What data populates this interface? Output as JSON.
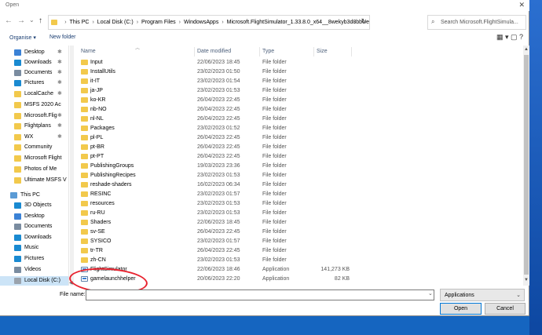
{
  "window": {
    "title": "Open",
    "close_glyph": "✕"
  },
  "nav_buttons": {
    "back": "←",
    "forward": "→",
    "dropdown": "⌄",
    "up": "↑"
  },
  "address": {
    "segments": [
      "This PC",
      "Local Disk (C:)",
      "Program Files",
      "WindowsApps",
      "Microsoft.FlightSimulator_1.33.8.0_x64__8wekyb3d8bbwe"
    ],
    "separator": "›",
    "dropdown": "⌄",
    "refresh": "↻"
  },
  "search": {
    "placeholder": "Search Microsoft.FlightSimula..."
  },
  "toolbar": {
    "organise_label": "Organise ▾",
    "new_folder_label": "New folder",
    "view_icons": "▦ ▾  ▢  ?"
  },
  "sidebar": {
    "items": [
      {
        "label": "Desktop",
        "icon": "folder-blue",
        "pinned": true
      },
      {
        "label": "Downloads",
        "icon": "download",
        "pinned": true
      },
      {
        "label": "Documents",
        "icon": "documents",
        "pinned": true
      },
      {
        "label": "Pictures",
        "icon": "pictures",
        "pinned": true
      },
      {
        "label": "LocalCache",
        "icon": "folder",
        "pinned": true
      },
      {
        "label": "MSFS 2020 Ac",
        "icon": "folder",
        "pinned": false
      },
      {
        "label": "Microsoft.Flig",
        "icon": "folder",
        "pinned": true
      },
      {
        "label": "Flightplans",
        "icon": "folder",
        "pinned": true
      },
      {
        "label": "WX",
        "icon": "folder",
        "pinned": true
      },
      {
        "label": "Community",
        "icon": "folder",
        "pinned": false
      },
      {
        "label": "Microsoft Flight",
        "icon": "folder",
        "pinned": false
      },
      {
        "label": "Photos of Me",
        "icon": "folder",
        "pinned": false
      },
      {
        "label": "Ultimate MSFS V",
        "icon": "folder",
        "pinned": false
      },
      {
        "label": "This PC",
        "icon": "pc",
        "pinned": false
      },
      {
        "label": "3D Objects",
        "icon": "3d",
        "pinned": false
      },
      {
        "label": "Desktop",
        "icon": "folder-blue",
        "pinned": false
      },
      {
        "label": "Documents",
        "icon": "documents",
        "pinned": false
      },
      {
        "label": "Downloads",
        "icon": "download",
        "pinned": false
      },
      {
        "label": "Music",
        "icon": "music",
        "pinned": false
      },
      {
        "label": "Pictures",
        "icon": "pictures",
        "pinned": false
      },
      {
        "label": "Videos",
        "icon": "videos",
        "pinned": false
      },
      {
        "label": "Local Disk (C:)",
        "icon": "disk",
        "pinned": false,
        "selected": true
      }
    ],
    "pin_glyph": "📌"
  },
  "columns": {
    "name": "Name",
    "date": "Date modified",
    "type": "Type",
    "size": "Size"
  },
  "files": [
    {
      "name": "Input",
      "date": "22/06/2023 18:45",
      "type": "File folder",
      "size": "",
      "kind": "folder"
    },
    {
      "name": "InstallUtils",
      "date": "23/02/2023 01:50",
      "type": "File folder",
      "size": "",
      "kind": "folder"
    },
    {
      "name": "it-IT",
      "date": "23/02/2023 01:54",
      "type": "File folder",
      "size": "",
      "kind": "folder"
    },
    {
      "name": "ja-JP",
      "date": "23/02/2023 01:53",
      "type": "File folder",
      "size": "",
      "kind": "folder"
    },
    {
      "name": "ko-KR",
      "date": "26/04/2023 22:45",
      "type": "File folder",
      "size": "",
      "kind": "folder"
    },
    {
      "name": "nb-NO",
      "date": "26/04/2023 22:45",
      "type": "File folder",
      "size": "",
      "kind": "folder"
    },
    {
      "name": "nl-NL",
      "date": "26/04/2023 22:45",
      "type": "File folder",
      "size": "",
      "kind": "folder"
    },
    {
      "name": "Packages",
      "date": "23/02/2023 01:52",
      "type": "File folder",
      "size": "",
      "kind": "folder"
    },
    {
      "name": "pl-PL",
      "date": "26/04/2023 22:45",
      "type": "File folder",
      "size": "",
      "kind": "folder"
    },
    {
      "name": "pt-BR",
      "date": "26/04/2023 22:45",
      "type": "File folder",
      "size": "",
      "kind": "folder"
    },
    {
      "name": "pt-PT",
      "date": "26/04/2023 22:45",
      "type": "File folder",
      "size": "",
      "kind": "folder"
    },
    {
      "name": "PublishingGroups",
      "date": "19/03/2023 23:36",
      "type": "File folder",
      "size": "",
      "kind": "folder"
    },
    {
      "name": "PublishingRecipes",
      "date": "23/02/2023 01:53",
      "type": "File folder",
      "size": "",
      "kind": "folder"
    },
    {
      "name": "reshade-shaders",
      "date": "16/02/2023 06:34",
      "type": "File folder",
      "size": "",
      "kind": "folder"
    },
    {
      "name": "RESINC",
      "date": "23/02/2023 01:57",
      "type": "File folder",
      "size": "",
      "kind": "folder"
    },
    {
      "name": "resources",
      "date": "23/02/2023 01:53",
      "type": "File folder",
      "size": "",
      "kind": "folder"
    },
    {
      "name": "ru-RU",
      "date": "23/02/2023 01:53",
      "type": "File folder",
      "size": "",
      "kind": "folder"
    },
    {
      "name": "Shaders",
      "date": "22/06/2023 18:45",
      "type": "File folder",
      "size": "",
      "kind": "folder"
    },
    {
      "name": "sv-SE",
      "date": "26/04/2023 22:45",
      "type": "File folder",
      "size": "",
      "kind": "folder"
    },
    {
      "name": "SYSICO",
      "date": "23/02/2023 01:57",
      "type": "File folder",
      "size": "",
      "kind": "folder"
    },
    {
      "name": "tr-TR",
      "date": "26/04/2023 22:45",
      "type": "File folder",
      "size": "",
      "kind": "folder"
    },
    {
      "name": "zh-CN",
      "date": "23/02/2023 01:53",
      "type": "File folder",
      "size": "",
      "kind": "folder"
    },
    {
      "name": "FlightSimulator",
      "date": "22/06/2023 18:46",
      "type": "Application",
      "size": "141,273 KB",
      "kind": "app"
    },
    {
      "name": "gamelaunchhelper",
      "date": "20/06/2023 22:20",
      "type": "Application",
      "size": "82 KB",
      "kind": "app"
    }
  ],
  "footer": {
    "filename_label": "File name:",
    "filename_value": "",
    "filetype_value": "Applications",
    "open_label": "Open",
    "cancel_label": "Cancel"
  },
  "colors": {
    "annotation": "#e8222e",
    "selection": "#cce4f7",
    "folder": "#f2c94c",
    "accent": "#0078d7"
  }
}
